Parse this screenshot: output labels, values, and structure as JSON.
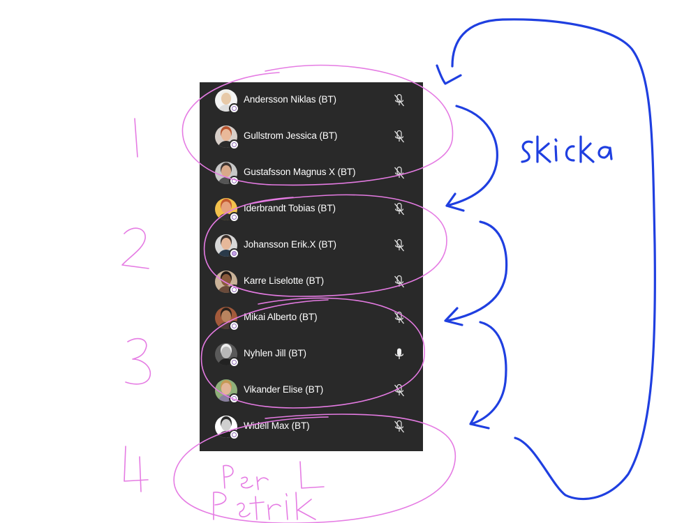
{
  "participants": [
    {
      "name": "Andersson Niklas (BT)",
      "muted": true,
      "skin": "#e7c9a8",
      "hair": "#f1efe8",
      "bg": "#f4f4f4",
      "shirt": "#ddd"
    },
    {
      "name": "Gullstrom Jessica (BT)",
      "muted": true,
      "skin": "#e9b99a",
      "hair": "#b5532e",
      "bg": "#d8cfc9",
      "shirt": "#2b2b2b"
    },
    {
      "name": "Gustafsson Magnus X (BT)",
      "muted": true,
      "skin": "#d9a98a",
      "hair": "#3e3430",
      "bg": "#c7c7c7",
      "shirt": "#555"
    },
    {
      "name": "Iderbrandt Tobias (BT)",
      "muted": true,
      "skin": "#e5a27e",
      "hair": "#c45a30",
      "bg": "#f3c14c",
      "shirt": "#333"
    },
    {
      "name": "Johansson Erik.X (BT)",
      "muted": true,
      "skin": "#e6b89a",
      "hair": "#3a2f2a",
      "bg": "#d7d7d7",
      "shirt": "#2a3a4a"
    },
    {
      "name": "Karre Liselotte (BT)",
      "muted": true,
      "skin": "#8a5a3c",
      "hair": "#231a16",
      "bg": "#c9b298",
      "shirt": "#6a4a3a"
    },
    {
      "name": "Mikai Alberto (BT)",
      "muted": true,
      "skin": "#b9845f",
      "hair": "#2c221c",
      "bg": "#a35a3b",
      "shirt": "#4a3b34"
    },
    {
      "name": "Nyhlen Jill (BT)",
      "muted": false,
      "skin": "#b8b8b8",
      "hair": "#eeeeee",
      "bg": "#5a5a5a",
      "shirt": "#222"
    },
    {
      "name": "Vikander Elise (BT)",
      "muted": true,
      "skin": "#e2b598",
      "hair": "#c79a55",
      "bg": "#8fb07a",
      "shirt": "#8a7fa0"
    },
    {
      "name": "Widell Max (BT)",
      "muted": true,
      "skin": "#cfcfcf",
      "hair": "#2a2a2a",
      "bg": "#ffffff",
      "shirt": "#222"
    }
  ],
  "annotations": {
    "group_numbers": [
      "1",
      "2",
      "3",
      "4"
    ],
    "skicka": "skicka",
    "extra_names": [
      "Per L",
      "Patrik"
    ],
    "pink": "#e57be3",
    "blue": "#1f3fe0"
  }
}
